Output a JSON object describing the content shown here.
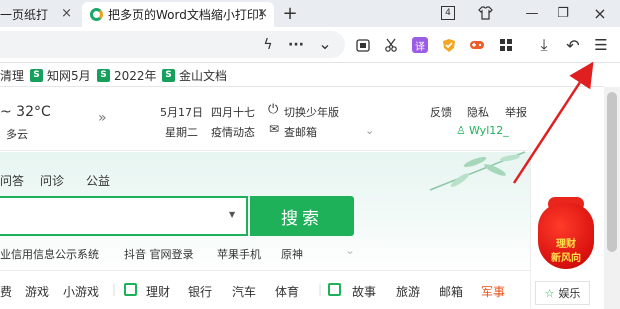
{
  "tabs": [
    {
      "label": "一页纸打",
      "close": "×"
    },
    {
      "label": "把多页的Word文档缩小打印到",
      "close": "×"
    }
  ],
  "tabbar": {
    "new_tab": "+",
    "tab_count": "4",
    "minimize": "—",
    "restore": "❐",
    "close": "×"
  },
  "toolbar": {
    "lightning": "ϟ",
    "more": "···",
    "dropdown": "⌄",
    "translate": "译",
    "download": "⤓",
    "undo": "↶",
    "menu": "☰"
  },
  "bookmarks": [
    {
      "label": "清理"
    },
    {
      "label": "知网5月"
    },
    {
      "label": "2022年"
    },
    {
      "label": "金山文档"
    }
  ],
  "info": {
    "weather_temp": "~ 32°C",
    "weather_cond": "多云",
    "date": "5月17日",
    "weekday": "星期二",
    "lunar": "四月十七",
    "epidemic": "疫情动态",
    "youth": "切换少年版",
    "mail": "查邮箱",
    "feedback": "反馈",
    "privacy": "隐私",
    "report": "举报",
    "user": "Wyl12_"
  },
  "hero": {
    "links": [
      "问答",
      "问诊",
      "公益"
    ],
    "search_button": "搜索",
    "hot": [
      "业信用信息公示系统",
      "抖音 官网登录",
      "苹果手机",
      "原神"
    ]
  },
  "nav": {
    "left": [
      "费",
      "游戏",
      "小游戏"
    ],
    "group1": [
      "理财",
      "银行",
      "汽车",
      "体育"
    ],
    "group2": [
      "故事",
      "旅游",
      "邮箱",
      "军事"
    ]
  },
  "side": {
    "bag_line1": "理财",
    "bag_line2": "新风向",
    "leisure": "娱乐"
  },
  "colors": {
    "brand_green": "#1fb15a",
    "military_red": "#e8531a",
    "arrow_red": "#e02020"
  }
}
